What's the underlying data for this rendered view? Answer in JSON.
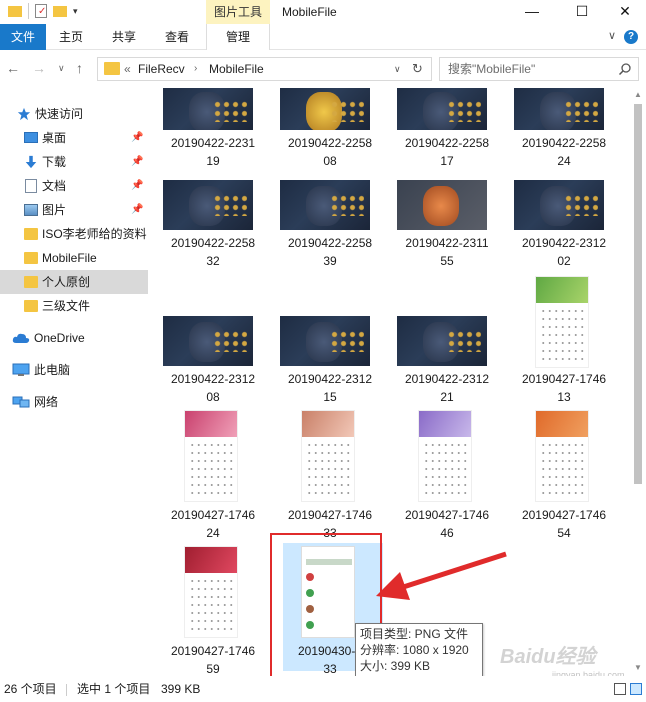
{
  "titlebar": {
    "context_group": "图片工具",
    "window_title": "MobileFile"
  },
  "ribbon": {
    "tabs": [
      "文件",
      "主页",
      "共享",
      "查看",
      "管理"
    ]
  },
  "address": {
    "prefix": "«",
    "path": [
      "FileRecv",
      "MobileFile"
    ]
  },
  "search": {
    "placeholder": "搜索\"MobileFile\""
  },
  "sidebar": {
    "quick_access": "快速访问",
    "items": [
      {
        "label": "桌面",
        "icon": "desktop-icon",
        "pinned": true
      },
      {
        "label": "下载",
        "icon": "download-icon",
        "pinned": true
      },
      {
        "label": "文档",
        "icon": "document-icon",
        "pinned": true
      },
      {
        "label": "图片",
        "icon": "picture-icon",
        "pinned": true
      },
      {
        "label": "ISO李老师给的资料",
        "icon": "folder-icon",
        "pinned": false
      },
      {
        "label": "MobileFile",
        "icon": "folder-icon",
        "pinned": false
      },
      {
        "label": "个人原创",
        "icon": "folder-icon",
        "pinned": false
      },
      {
        "label": "三级文件",
        "icon": "folder-icon",
        "pinned": false
      }
    ],
    "onedrive": "OneDrive",
    "this_pc": "此电脑",
    "network": "网络"
  },
  "files": [
    {
      "line1": "20190422-2231",
      "line2": "19"
    },
    {
      "line1": "20190422-2258",
      "line2": "08"
    },
    {
      "line1": "20190422-2258",
      "line2": "17"
    },
    {
      "line1": "20190422-2258",
      "line2": "24"
    },
    {
      "line1": "20190422-2258",
      "line2": "32"
    },
    {
      "line1": "20190422-2258",
      "line2": "39"
    },
    {
      "line1": "20190422-2311",
      "line2": "55"
    },
    {
      "line1": "20190422-2312",
      "line2": "02"
    },
    {
      "line1": "20190422-2312",
      "line2": "08"
    },
    {
      "line1": "20190422-2312",
      "line2": "15"
    },
    {
      "line1": "20190422-2312",
      "line2": "21"
    },
    {
      "line1": "20190427-1746",
      "line2": "13"
    },
    {
      "line1": "20190427-1746",
      "line2": "24"
    },
    {
      "line1": "20190427-1746",
      "line2": "33"
    },
    {
      "line1": "20190427-1746",
      "line2": "46"
    },
    {
      "line1": "20190427-1746",
      "line2": "54"
    },
    {
      "line1": "20190427-1746",
      "line2": "59"
    },
    {
      "line1": "20190430-1",
      "line2": "33"
    }
  ],
  "tooltip": {
    "type": "项目类型: PNG 文件",
    "resolution": "分辨率: 1080 x 1920",
    "size": "大小: 399 KB"
  },
  "status": {
    "count": "26 个项目",
    "selected": "选中 1 个项目",
    "size": "399 KB"
  },
  "watermark": {
    "brand": "Baidu经验",
    "url": "jingyan.baidu.com"
  },
  "colors": {
    "file_tab": "#1979ca",
    "context_tab": "#fdf3c0",
    "selection": "#cce8ff",
    "highlight_red": "#e02b2b"
  }
}
